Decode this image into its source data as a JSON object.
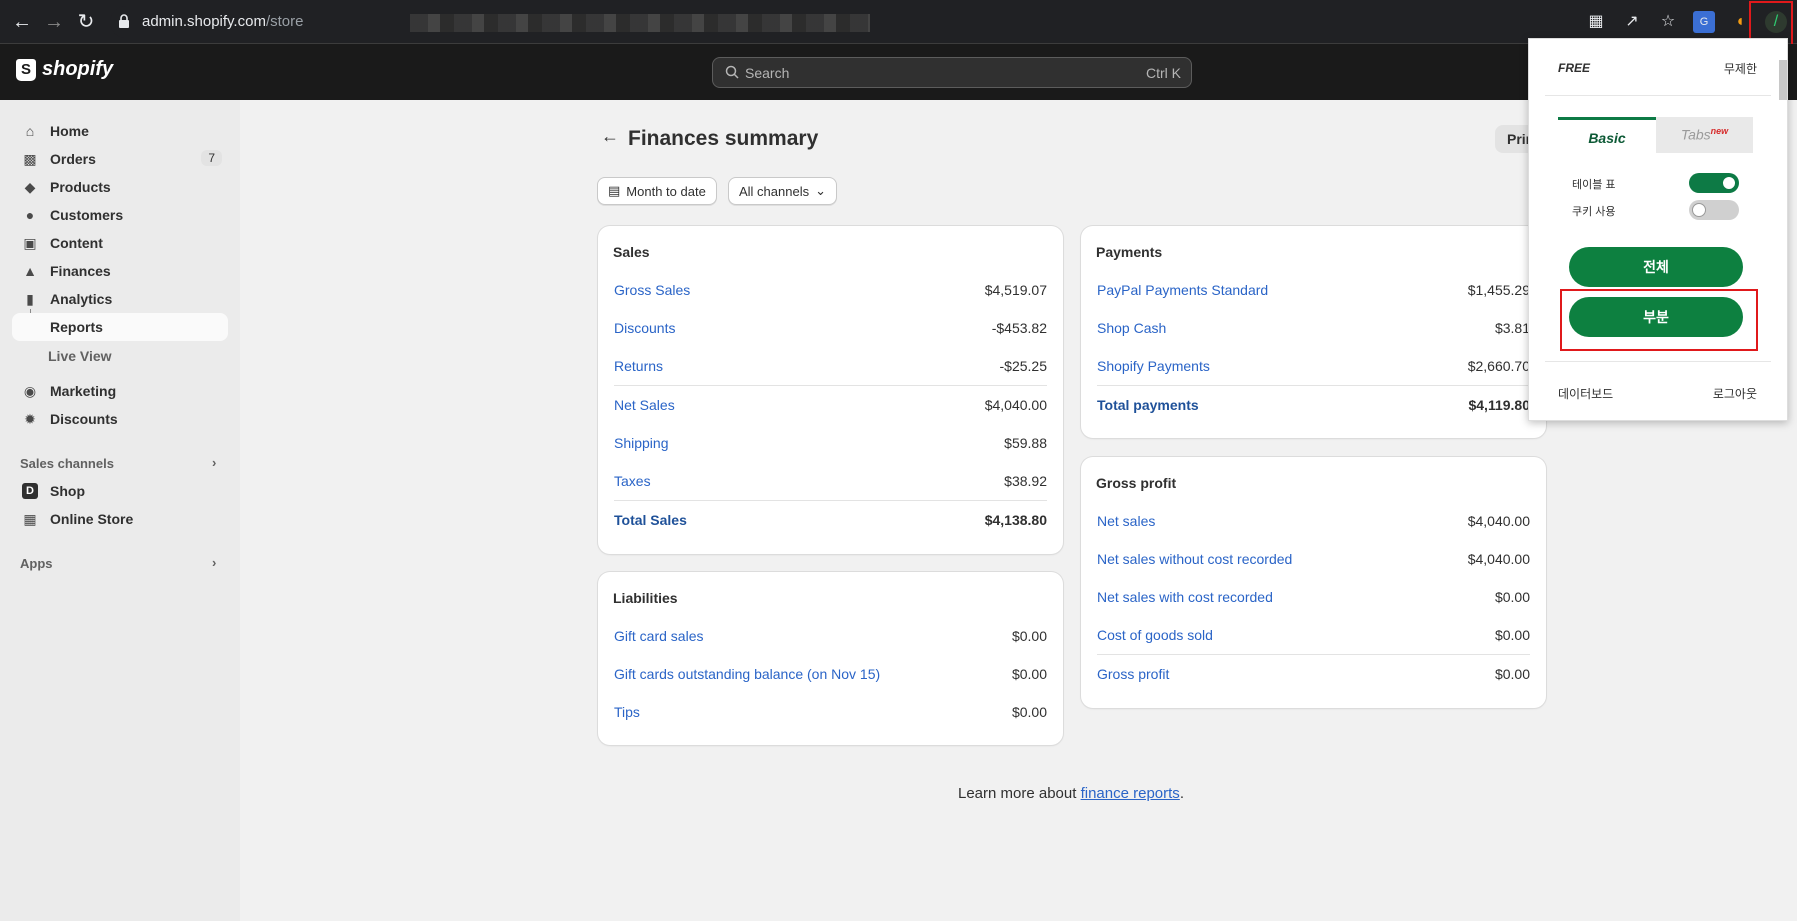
{
  "browser": {
    "url_host": "admin.shopify.com",
    "url_path": "/store"
  },
  "topbar": {
    "brand": "shopify",
    "search_placeholder": "Search",
    "search_shortcut": "Ctrl K"
  },
  "sidebar": {
    "items": [
      {
        "label": "Home",
        "icon": "home-icon"
      },
      {
        "label": "Orders",
        "icon": "inbox-icon",
        "badge": "7"
      },
      {
        "label": "Products",
        "icon": "tag-icon"
      },
      {
        "label": "Customers",
        "icon": "person-icon"
      },
      {
        "label": "Content",
        "icon": "image-icon"
      },
      {
        "label": "Finances",
        "icon": "bank-icon"
      },
      {
        "label": "Analytics",
        "icon": "bar-chart-icon"
      },
      {
        "label": "Reports",
        "icon": "tree-branch-icon"
      },
      {
        "label": "Live View"
      },
      {
        "label": "Marketing",
        "icon": "target-icon"
      },
      {
        "label": "Discounts",
        "icon": "discount-icon"
      }
    ],
    "sales_channels_label": "Sales channels",
    "channels": [
      {
        "label": "Shop",
        "icon": "shop-icon"
      },
      {
        "label": "Online Store",
        "icon": "store-icon"
      }
    ],
    "apps_label": "Apps"
  },
  "main": {
    "title": "Finances summary",
    "print_label": "Print",
    "filters": {
      "date": "Month to date",
      "channels": "All channels"
    },
    "sales": {
      "title": "Sales",
      "rows": [
        {
          "label": "Gross Sales",
          "value": "$4,519.07"
        },
        {
          "label": "Discounts",
          "value": "-$453.82"
        },
        {
          "label": "Returns",
          "value": "-$25.25"
        },
        {
          "label": "Net Sales",
          "value": "$4,040.00"
        },
        {
          "label": "Shipping",
          "value": "$59.88"
        },
        {
          "label": "Taxes",
          "value": "$38.92"
        },
        {
          "label": "Total Sales",
          "value": "$4,138.80"
        }
      ]
    },
    "payments": {
      "title": "Payments",
      "rows": [
        {
          "label": "PayPal Payments Standard",
          "value": "$1,455.29"
        },
        {
          "label": "Shop Cash",
          "value": "$3.81"
        },
        {
          "label": "Shopify Payments",
          "value": "$2,660.70"
        },
        {
          "label": "Total payments",
          "value": "$4,119.80"
        }
      ]
    },
    "liabilities": {
      "title": "Liabilities",
      "rows": [
        {
          "label": "Gift card sales",
          "value": "$0.00"
        },
        {
          "label": "Gift cards outstanding balance (on Nov 15)",
          "value": "$0.00"
        },
        {
          "label": "Tips",
          "value": "$0.00"
        }
      ]
    },
    "gross_profit": {
      "title": "Gross profit",
      "rows": [
        {
          "label": "Net sales",
          "value": "$4,040.00"
        },
        {
          "label": "Net sales without cost recorded",
          "value": "$4,040.00"
        },
        {
          "label": "Net sales with cost recorded",
          "value": "$0.00"
        },
        {
          "label": "Cost of goods sold",
          "value": "$0.00"
        },
        {
          "label": "Gross profit",
          "value": "$0.00"
        }
      ]
    },
    "learn_more_prefix": "Learn more about ",
    "learn_more_link": "finance reports",
    "learn_more_suffix": "."
  },
  "popup": {
    "plan": "FREE",
    "unlimited": "무제한",
    "tab_basic": "Basic",
    "tab_tabs": "Tabs",
    "tab_tabs_badge": "new",
    "toggle_table_label": "테이블 표",
    "toggle_table_on": true,
    "toggle_cookie_label": "쿠키 사용",
    "toggle_cookie_on": false,
    "btn_all": "전체",
    "btn_partial": "부분",
    "dashboard": "데이터보드",
    "logout": "로그아웃",
    "accent": "#0d8040"
  }
}
